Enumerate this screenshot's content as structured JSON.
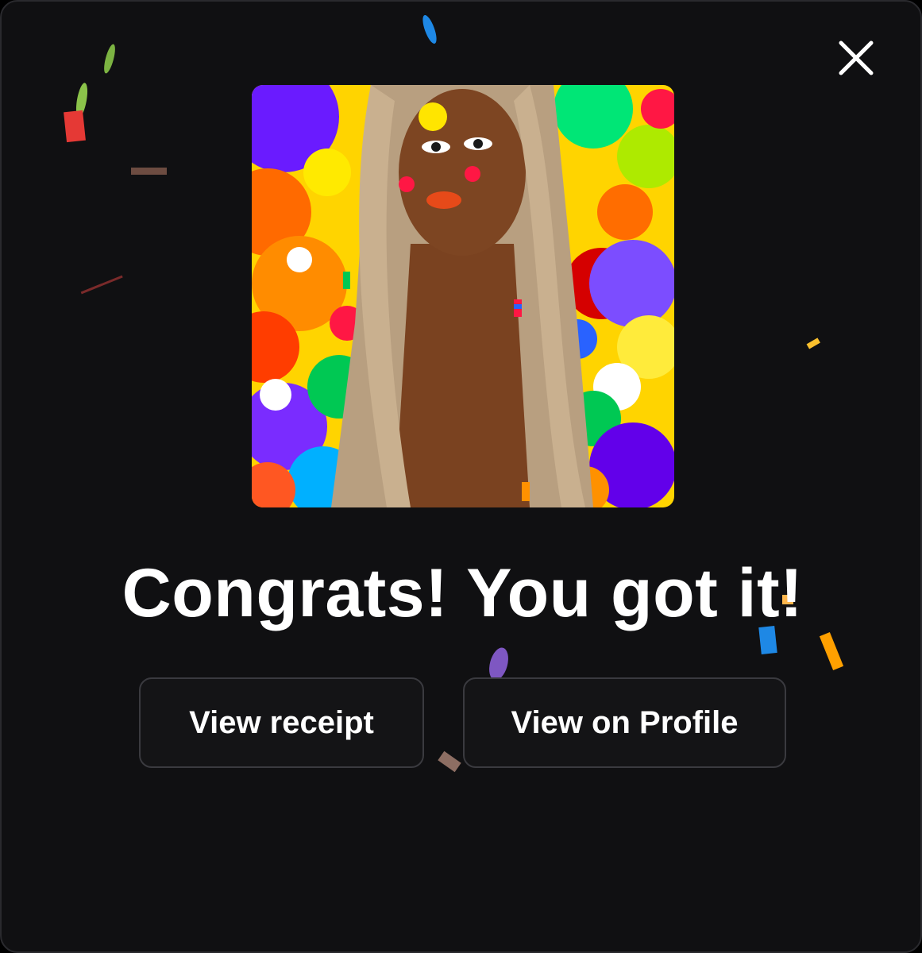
{
  "modal": {
    "headline": "Congrats! You got it!",
    "close_icon": "close-icon",
    "artwork_alt": "",
    "buttons": {
      "view_receipt": "View receipt",
      "view_on_profile": "View on Profile"
    }
  },
  "colors": {
    "background": "#101012",
    "button_background": "#141416",
    "button_border": "#3a3a3f",
    "text": "#ffffff"
  }
}
